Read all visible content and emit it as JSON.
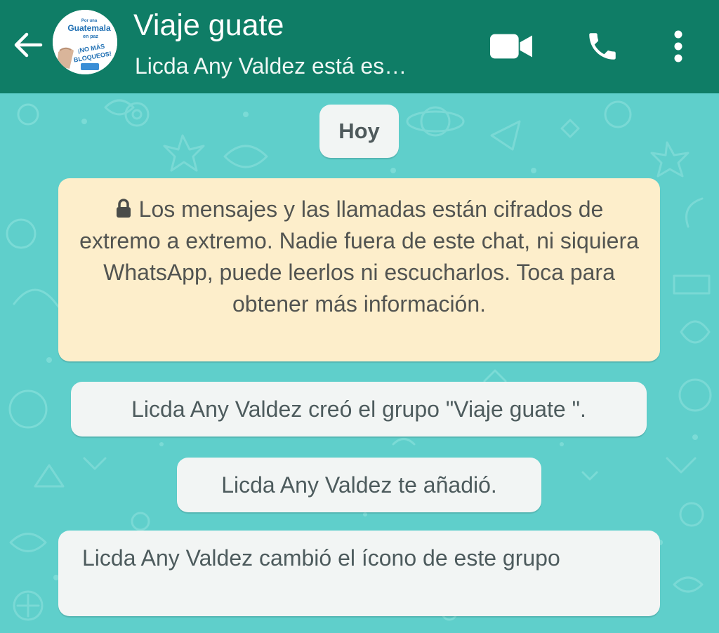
{
  "header": {
    "title": "Viaje guate",
    "subtitle": "Licda Any Valdez  está es…",
    "avatar_text": [
      "Por una",
      "Guatemala",
      "en paz",
      "¡NO MÁS",
      "BLOQUEOS!"
    ],
    "icons": {
      "back": "arrow-left-icon",
      "video": "video-camera-icon",
      "call": "phone-icon",
      "menu": "more-vertical-icon"
    }
  },
  "chat": {
    "date_chip": "Hoy",
    "encryption_notice": "Los mensajes y las llamadas están cifrados de extremo a extremo. Nadie fuera de este chat, ni siquiera WhatsApp, puede leerlos ni escucharlos. Toca para obtener más información.",
    "system_messages": [
      "Licda Any Valdez creó el grupo \"Viaje guate \".",
      "Licda Any Valdez te añadió.",
      "Licda Any Valdez cambió el ícono de este grupo"
    ]
  },
  "colors": {
    "header_bg": "#0f7d66",
    "chat_bg": "#5fcfcb",
    "notice_bg": "#fdeecb",
    "bubble_bg": "#f2f5f4"
  }
}
